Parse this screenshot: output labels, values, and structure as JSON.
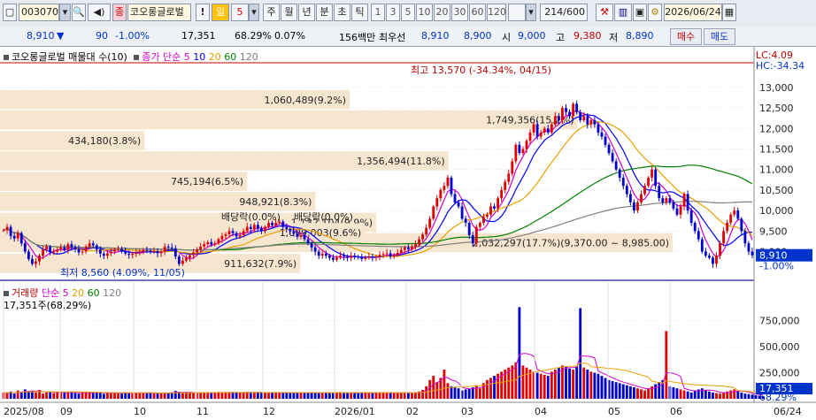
{
  "toolbar": {
    "code": "003070",
    "stock_name": "코오롱글로벌",
    "bang": "!",
    "period_selected": "일",
    "period_count": "5",
    "periods": [
      "주",
      "월",
      "년",
      "분",
      "초",
      "틱"
    ],
    "intervals": [
      "1",
      "3",
      "5",
      "10",
      "20",
      "30",
      "60",
      "120"
    ],
    "count": "214/600",
    "date": "2026/06/24"
  },
  "info": {
    "price": "8,910",
    "change": "90",
    "change_pct": "-1.00%",
    "volume": "17,351",
    "vol_ratio": "68.29%",
    "turnover": "0.07%",
    "amount": "156백만",
    "best_label": "최우선",
    "ask": "8,910",
    "bid": "8,900",
    "open_label": "시",
    "open": "9,000",
    "high_label": "고",
    "high": "9,380",
    "low_label": "저",
    "low": "8,890",
    "buy_label": "매수",
    "sell_label": "매도"
  },
  "chart_data": [
    {
      "type": "candlestick",
      "title": "코오롱글로벌 매물대 수(10)",
      "ma_label": "종가 단순",
      "ma_periods": [
        "5",
        "10",
        "20",
        "60",
        "120"
      ],
      "ma_colors": [
        "#d000d0",
        "#0000ff",
        "#e8a000",
        "#008000",
        "#808080"
      ],
      "x_ticks": [
        "2025/08",
        "09",
        "10",
        "11",
        "12",
        "2026/01",
        "02",
        "03",
        "04",
        "05",
        "06",
        "06/24"
      ],
      "y_ticks": [
        "13,000",
        "12,500",
        "12,000",
        "11,500",
        "11,000",
        "10,500",
        "10,000",
        "9,500",
        "9,000"
      ],
      "ylim": [
        8300,
        13600
      ],
      "right_top_labels": [
        "LC:4.09",
        "HC:-34.34"
      ],
      "current_price_label": "8,910",
      "current_change_label": "-1.00%",
      "annotations": {
        "high": "최고 13,570 (-34.34%, 04/15)",
        "low": "최저 8,560 (4.09%, 11/05)",
        "dividend1": "배당락(0.0%)",
        "dividend2": "배당락(0.0%)"
      },
      "volume_profile": [
        {
          "price": 12700,
          "label": "1,060,489(9.2%)",
          "share": 9.2
        },
        {
          "price": 12210,
          "label": "1,749,356(15.2%)",
          "share": 15.2
        },
        {
          "price": 11700,
          "label": "434,180(3.8%)",
          "share": 3.8
        },
        {
          "price": 11210,
          "label": "1,356,494(11.8%)",
          "share": 11.8
        },
        {
          "price": 10710,
          "label": "745,194(6.5%)",
          "share": 6.5
        },
        {
          "price": 10220,
          "label": "948,921(8.3%)",
          "share": 8.3
        },
        {
          "price": 9710,
          "label": "1,132,104(9.9%)",
          "share": 9.9
        },
        {
          "price": 9220,
          "label": "2,032,297(17.7%)(9,370.00 ~ 8,985.00)",
          "share": 17.7
        },
        {
          "price": 8710,
          "label": "911,632(7.9%)",
          "share": 7.9
        },
        {
          "price": 9460,
          "label": "1,099,003(9.6%)",
          "share": 9.6
        }
      ],
      "closes": [
        9520,
        9600,
        9380,
        9320,
        9450,
        9200,
        9000,
        8820,
        8700,
        8760,
        8900,
        9050,
        9120,
        8980,
        9000,
        9050,
        9100,
        9040,
        9180,
        9110,
        9060,
        8980,
        9000,
        9120,
        9200,
        9150,
        9050,
        8950,
        8900,
        8960,
        9000,
        9050,
        9060,
        9000,
        8950,
        8920,
        8950,
        8980,
        9000,
        9040,
        9020,
        8990,
        9010,
        8960,
        9000,
        9120,
        9100,
        9080,
        8880,
        8700,
        8780,
        8850,
        8910,
        8980,
        9050,
        9120,
        9180,
        9230,
        9170,
        9200,
        9300,
        9380,
        9420,
        9500,
        9450,
        9370,
        9400,
        9500,
        9600,
        9550,
        9650,
        9560,
        9500,
        9600,
        9700,
        9640,
        9700,
        9730,
        9600,
        9550,
        9500,
        9440,
        9360,
        9400,
        9300,
        9200,
        9100,
        9000,
        8900,
        8950,
        8900,
        8850,
        8800,
        8850,
        8900,
        8880,
        8850,
        8900,
        8880,
        8870,
        8820,
        8850,
        8880,
        8860,
        8880,
        8920,
        8940,
        8960,
        8880,
        8920,
        8970,
        9040,
        9100,
        9060,
        9120,
        9180,
        9300,
        9420,
        9580,
        9800,
        10100,
        10300,
        10500,
        10600,
        10800,
        10400,
        10200,
        10100,
        9800,
        9700,
        9400,
        9200,
        9600,
        9700,
        9850,
        9900,
        10100,
        10050,
        10300,
        10500,
        10700,
        10900,
        11200,
        11600,
        11400,
        11500,
        11700,
        11900,
        12100,
        11800,
        11900,
        12000,
        11900,
        12100,
        12300,
        12200,
        12500,
        12400,
        12300,
        12600,
        12400,
        12200,
        12300,
        12100,
        12200,
        12100,
        11900,
        11800,
        11600,
        11400,
        11200,
        11000,
        10800,
        10600,
        10400,
        10200,
        10000,
        10200,
        10400,
        10600,
        10800,
        11000,
        10600,
        10300,
        10200,
        10300,
        10200,
        10050,
        9900,
        10100,
        10400,
        10000,
        9700,
        9500,
        9300,
        9000,
        8900,
        8850,
        8700,
        8900,
        9200,
        9500,
        9700,
        9900,
        10000,
        9800,
        9500,
        9200,
        9000,
        8910
      ],
      "volumes": [
        60,
        55,
        70,
        50,
        80,
        65,
        90,
        70,
        75,
        60,
        85,
        50,
        60,
        70,
        55,
        65,
        60,
        58,
        62,
        70,
        55,
        50,
        60,
        65,
        58,
        55,
        62,
        60,
        48,
        52,
        58,
        60,
        55,
        50,
        62,
        58,
        55,
        52,
        60,
        58,
        55,
        60,
        52,
        50,
        58,
        60,
        55,
        62,
        75,
        65,
        55,
        58,
        60,
        62,
        58,
        55,
        62,
        60,
        58,
        55,
        65,
        62,
        60,
        58,
        62,
        60,
        58,
        62,
        65,
        60,
        58,
        62,
        60,
        58,
        55,
        60,
        62,
        58,
        60,
        55,
        58,
        62,
        60,
        58,
        55,
        62,
        58,
        55,
        60,
        58,
        62,
        55,
        60,
        58,
        62,
        55,
        58,
        60,
        62,
        55,
        60,
        58,
        62,
        55,
        58,
        60,
        62,
        58,
        55,
        60,
        58,
        62,
        60,
        58,
        55,
        62,
        70,
        85,
        120,
        180,
        220,
        160,
        200,
        280,
        150,
        120,
        110,
        100,
        80,
        90,
        95,
        110,
        130,
        100,
        150,
        180,
        200,
        220,
        240,
        260,
        280,
        300,
        320,
        350,
        880,
        320,
        300,
        280,
        260,
        250,
        240,
        230,
        220,
        260,
        280,
        300,
        320,
        310,
        290,
        280,
        310,
        870,
        300,
        280,
        260,
        250,
        240,
        220,
        200,
        180,
        170,
        160,
        150,
        140,
        130,
        120,
        110,
        100,
        90,
        80,
        100,
        120,
        140,
        160,
        180,
        650,
        120,
        110,
        100,
        90,
        80,
        70,
        60,
        80,
        90,
        100,
        80,
        70,
        60,
        55,
        50,
        60,
        70,
        80,
        90,
        75,
        60,
        50,
        45,
        40,
        35,
        30,
        25
      ],
      "volume_chart": {
        "title": "거래량",
        "ma_label": "단순",
        "ma_periods": [
          "5",
          "20",
          "60",
          "120"
        ],
        "current_label": "17,351주(68.29%)",
        "y_ticks": [
          "750,000",
          "500,000",
          "250,000"
        ],
        "right_value": "17,351",
        "right_pct": "68.29%"
      }
    }
  ]
}
